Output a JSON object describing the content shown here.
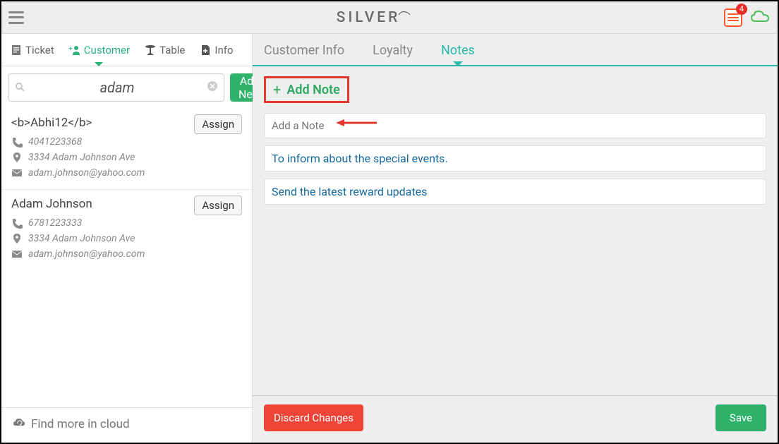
{
  "topbar": {
    "brand": "SILVER",
    "notif_count": "4"
  },
  "left_tabs": [
    {
      "id": "ticket",
      "label": "Ticket",
      "icon": "receipt-icon",
      "active": false
    },
    {
      "id": "customer",
      "label": "Customer",
      "icon": "add-person-icon",
      "active": true
    },
    {
      "id": "table",
      "label": "Table",
      "icon": "table-pedestal-icon",
      "active": false
    },
    {
      "id": "info",
      "label": "Info",
      "icon": "note-plus-icon",
      "active": false
    }
  ],
  "search": {
    "value": "adam",
    "add_new_label": "Add New"
  },
  "customers": [
    {
      "name": "<b>Abhi12</b>",
      "phone": "4041223368",
      "address": "3334 Adam Johnson Ave",
      "email": "adam.johnson@yahoo.com",
      "assign_label": "Assign"
    },
    {
      "name": "Adam Johnson",
      "phone": "6781223333",
      "address": "3334 Adam Johnson Ave",
      "email": "adam.johnson@yahoo.com",
      "assign_label": "Assign"
    }
  ],
  "left_footer": {
    "label": "Find more in cloud"
  },
  "right_tabs": [
    {
      "id": "info",
      "label": "Customer Info",
      "active": false
    },
    {
      "id": "loyalty",
      "label": "Loyalty",
      "active": false
    },
    {
      "id": "notes",
      "label": "Notes",
      "active": true
    }
  ],
  "add_note_button": "Add Note",
  "note_input_placeholder": "Add a Note",
  "notes": [
    "To inform about the special events.",
    "Send the latest reward updates"
  ],
  "footer": {
    "discard": "Discard Changes",
    "save": "Save"
  },
  "colors": {
    "accent_green": "#2fb36b",
    "teal": "#2ab9a9",
    "red": "#ef4438",
    "highlight_border": "#e03a2f",
    "link_blue": "#1469a0"
  }
}
